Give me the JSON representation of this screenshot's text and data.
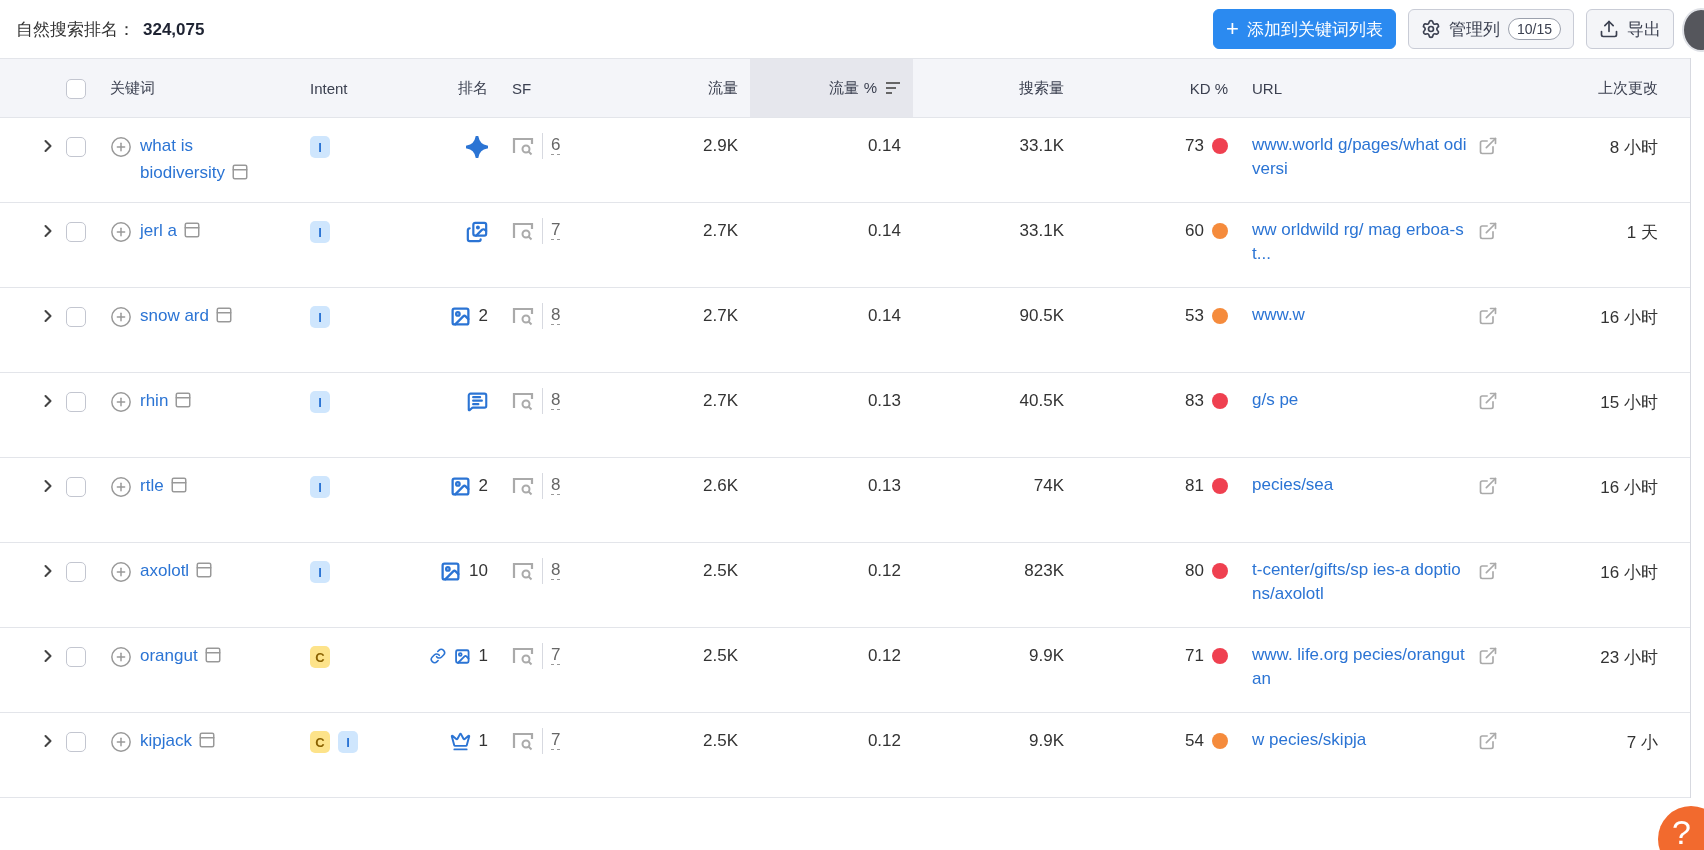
{
  "summary": {
    "label": "自然搜索排名：",
    "value": "324,075"
  },
  "toolbar": {
    "add_button": {
      "icon": "+",
      "label": "添加到关键词列表"
    },
    "columns_button": {
      "label": "管理列",
      "count": "10/15"
    },
    "export_button": {
      "label": "导出"
    }
  },
  "table": {
    "columns": [
      {
        "label": "关键词",
        "sorted": false
      },
      {
        "label": "Intent",
        "sorted": false
      },
      {
        "label": "排名",
        "sorted": false
      },
      {
        "label": "SF",
        "sorted": false
      },
      {
        "label": "流量",
        "sorted": false
      },
      {
        "label": "流量 %",
        "sorted": true
      },
      {
        "label": "搜索量",
        "sorted": false
      },
      {
        "label": "KD %",
        "sorted": false
      },
      {
        "label": "URL",
        "sorted": false
      },
      {
        "label": "上次更改",
        "sorted": false
      }
    ],
    "header_checked": false,
    "rows": [
      {
        "checked": false,
        "keyword": "what is biodiversity",
        "intents": [
          {
            "kind": "informational",
            "label": "I"
          }
        ],
        "rank_features": [
          {
            "kind": "ai"
          }
        ],
        "sf": "6",
        "traffic": "2.9K",
        "traffic_pct": "0.14",
        "volume": "33.1K",
        "kd": "73",
        "color": "#ef4050",
        "url": "www.world g/pages/what odiversi",
        "updated": "8 小时"
      },
      {
        "checked": false,
        "keyword": "jerl a",
        "intents": [
          {
            "kind": "informational",
            "label": "I"
          }
        ],
        "rank_features": [
          {
            "kind": "images"
          }
        ],
        "sf": "7",
        "traffic": "2.7K",
        "traffic_pct": "0.14",
        "volume": "33.1K",
        "kd": "60",
        "color": "#f58b3c",
        "url": "ww orldwild rg/ mag erboa-st...",
        "updated": "1 天"
      },
      {
        "checked": false,
        "keyword": "snow ard",
        "intents": [
          {
            "kind": "informational",
            "label": "I"
          }
        ],
        "rank_features": [
          {
            "kind": "image"
          }
        ],
        "rank": "2",
        "sf": "8",
        "traffic": "2.7K",
        "traffic_pct": "0.14",
        "volume": "90.5K",
        "kd": "53",
        "color": "#f58b3c",
        "url": "www.w",
        "updated": "16 小时"
      },
      {
        "checked": false,
        "keyword": "rhin",
        "intents": [
          {
            "kind": "informational",
            "label": "I"
          }
        ],
        "rank_features": [
          {
            "kind": "qa"
          }
        ],
        "sf": "8",
        "traffic": "2.7K",
        "traffic_pct": "0.13",
        "volume": "40.5K",
        "kd": "83",
        "color": "#ef4050",
        "url": "g/s pe",
        "updated": "15 小时"
      },
      {
        "checked": false,
        "keyword": "rtle",
        "intents": [
          {
            "kind": "informational",
            "label": "I"
          }
        ],
        "rank_features": [
          {
            "kind": "image"
          }
        ],
        "rank": "2",
        "sf": "8",
        "traffic": "2.6K",
        "traffic_pct": "0.13",
        "volume": "74K",
        "kd": "81",
        "color": "#ef4050",
        "url": "pecies/sea",
        "updated": "16 小时"
      },
      {
        "checked": false,
        "keyword": "axolotl",
        "intents": [
          {
            "kind": "informational",
            "label": "I"
          }
        ],
        "rank_features": [
          {
            "kind": "image"
          }
        ],
        "rank": "10",
        "sf": "8",
        "traffic": "2.5K",
        "traffic_pct": "0.12",
        "volume": "823K",
        "kd": "80",
        "color": "#ef4050",
        "url": "t-center/gifts/sp ies-a doptions/axolotl",
        "updated": "16 小时"
      },
      {
        "checked": false,
        "keyword": "orangut",
        "intents": [
          {
            "kind": "commercial",
            "label": "C"
          }
        ],
        "rank_features": [
          {
            "kind": "link"
          },
          {
            "kind": "image"
          }
        ],
        "rank": "1",
        "sf": "7",
        "traffic": "2.5K",
        "traffic_pct": "0.12",
        "volume": "9.9K",
        "kd": "71",
        "color": "#ef4050",
        "url": "www. life.org pecies/orangutan",
        "updated": "23 小时"
      },
      {
        "checked": false,
        "keyword": "kipjack",
        "intents": [
          {
            "kind": "commercial",
            "label": "C"
          },
          {
            "kind": "informational",
            "label": "I"
          }
        ],
        "rank_features": [
          {
            "kind": "crown"
          }
        ],
        "rank": "1",
        "sf": "7",
        "traffic": "2.5K",
        "traffic_pct": "0.12",
        "volume": "9.9K",
        "kd": "54",
        "color": "#f58b3c",
        "url": "w pecies/skipja",
        "updated": "7 小"
      }
    ]
  },
  "help_button": {
    "label": "?"
  }
}
